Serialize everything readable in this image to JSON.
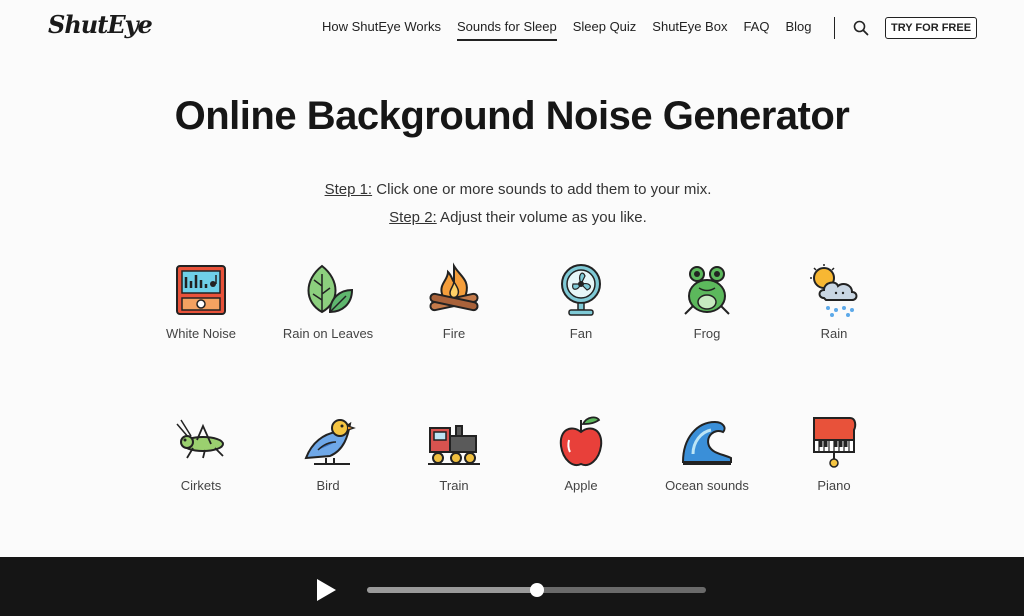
{
  "brand": {
    "logo": "ShutEye"
  },
  "nav": {
    "items": [
      {
        "label": "How ShutEye Works",
        "active": false
      },
      {
        "label": "Sounds for Sleep",
        "active": true
      },
      {
        "label": "Sleep Quiz",
        "active": false
      },
      {
        "label": "ShutEye Box",
        "active": false
      },
      {
        "label": "FAQ",
        "active": false
      },
      {
        "label": "Blog",
        "active": false
      }
    ],
    "cta": "TRY FOR FREE"
  },
  "main": {
    "title": "Online Background Noise Generator",
    "step1_key": "Step 1:",
    "step1_text": " Click one or more sounds to add them to your mix.",
    "step2_key": "Step 2:",
    "step2_text": " Adjust their volume as you like."
  },
  "sounds": [
    {
      "label": "White Noise",
      "icon": "white-noise-icon"
    },
    {
      "label": "Rain on Leaves",
      "icon": "leaves-icon"
    },
    {
      "label": "Fire",
      "icon": "campfire-icon"
    },
    {
      "label": "Fan",
      "icon": "fan-icon"
    },
    {
      "label": "Frog",
      "icon": "frog-icon"
    },
    {
      "label": "Rain",
      "icon": "rain-cloud-icon"
    },
    {
      "label": "Cirkets",
      "icon": "cricket-icon"
    },
    {
      "label": "Bird",
      "icon": "bird-icon"
    },
    {
      "label": "Train",
      "icon": "train-icon"
    },
    {
      "label": "Apple",
      "icon": "apple-icon"
    },
    {
      "label": "Ocean sounds",
      "icon": "wave-icon"
    },
    {
      "label": "Piano",
      "icon": "piano-icon"
    }
  ],
  "player": {
    "progress": 0.5
  },
  "colors": {
    "player_bg": "#151515",
    "accent": "#e8523a"
  }
}
